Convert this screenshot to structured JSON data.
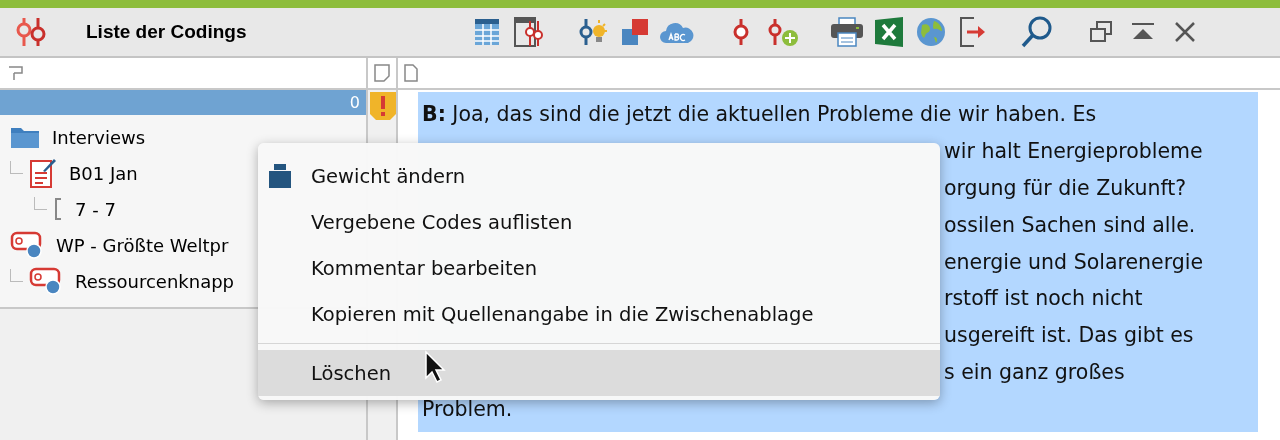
{
  "window": {
    "title": "Liste der Codings"
  },
  "tree_header": {
    "count": "0"
  },
  "tree": [
    {
      "label": "Interviews",
      "kind": "folder",
      "children": [
        {
          "label": "B01 Jan",
          "kind": "document",
          "children": [
            {
              "label": "7 - 7",
              "kind": "segment"
            }
          ]
        }
      ]
    },
    {
      "label": "WP - Größte Weltpr",
      "kind": "code",
      "children": [
        {
          "label": "Ressourcenknapp",
          "kind": "code"
        }
      ]
    }
  ],
  "text_lines": [
    {
      "text": "**B:** Joa, das sind die jetzt die aktuellen Probleme die wir haben. Es",
      "kind": "full"
    },
    {
      "text": "wir halt Energieprobleme",
      "kind": "partial"
    },
    {
      "text": "orgung für die Zukunft?",
      "kind": "partial"
    },
    {
      "text": "ossilen Sachen sind alle.",
      "kind": "partial"
    },
    {
      "text": "energie und Solarenergie",
      "kind": "partial"
    },
    {
      "text": "rstoff ist noch nicht",
      "kind": "partial"
    },
    {
      "text": "usgereift ist. Das gibt es",
      "kind": "partial"
    },
    {
      "text": "s ein ganz großes",
      "kind": "partial"
    },
    {
      "text": "Problem.",
      "kind": "full"
    }
  ],
  "context_menu": [
    {
      "label": "Gewicht ändern",
      "kind": "weight",
      "selected": false,
      "separator_before": false
    },
    {
      "label": "Vergebene Codes auflisten",
      "kind": "plain",
      "selected": false,
      "separator_before": false
    },
    {
      "label": "Kommentar bearbeiten",
      "kind": "plain",
      "selected": false,
      "separator_before": false
    },
    {
      "label": "Kopieren mit Quellenangabe in die Zwischenablage",
      "kind": "plain",
      "selected": false,
      "separator_before": false
    },
    {
      "label": "Löschen",
      "kind": "plain",
      "selected": true,
      "separator_before": true
    }
  ]
}
